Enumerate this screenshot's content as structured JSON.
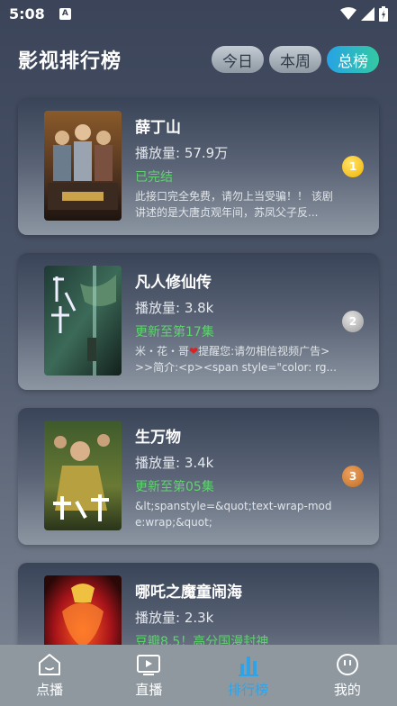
{
  "status_bar": {
    "time": "5:08",
    "app_icon": "A"
  },
  "header": {
    "title": "影视排行榜",
    "tabs": [
      {
        "label": "今日",
        "active": false
      },
      {
        "label": "本周",
        "active": false
      },
      {
        "label": "总榜",
        "active": true
      }
    ]
  },
  "items": [
    {
      "title": "薛丁山",
      "plays": "播放量: 57.9万",
      "status": "已完结",
      "desc": "此接口完全免费，请勿上当受骗！！ 该剧讲述的是大唐贞观年间，苏凤父子反...",
      "rank": "1"
    },
    {
      "title": "凡人修仙传",
      "plays": "播放量: 3.8k",
      "status": "更新至第17集",
      "desc_prefix": "米・花・哥",
      "desc": "提醒您:请勿相信视频广告>>>简介:<p><span style=\"color: rg...",
      "rank": "2"
    },
    {
      "title": "生万物",
      "plays": "播放量: 3.4k",
      "status": "更新至第05集",
      "desc": "&lt;spanstyle=&quot;text-wrap-mode:wrap;&quot;",
      "rank": "3"
    },
    {
      "title": "哪吒之魔童闹海",
      "plays": "播放量: 2.3k",
      "status": "豆瓣8.5！高分国漫封神",
      "desc": "",
      "rank": ""
    }
  ],
  "bottom_nav": [
    {
      "label": "点播",
      "icon": "home-icon",
      "active": false
    },
    {
      "label": "直播",
      "icon": "play-icon",
      "active": false
    },
    {
      "label": "排行榜",
      "icon": "bar-chart-icon",
      "active": true
    },
    {
      "label": "我的",
      "icon": "face-icon",
      "active": false
    }
  ],
  "colors": {
    "accent": "#2fa3e6",
    "status_green": "#5fd46e",
    "rank_gold": "#f2b300",
    "rank_silver": "#9c9c9c",
    "rank_bronze": "#c06d24"
  }
}
